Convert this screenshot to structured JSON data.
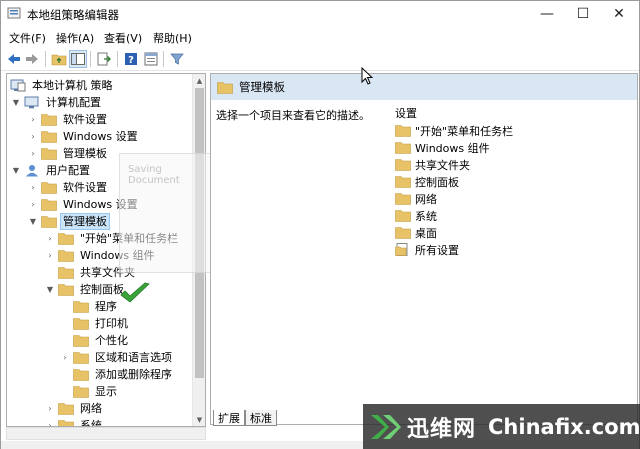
{
  "window": {
    "title": "本地组策略编辑器",
    "controls": {
      "minimize": "—",
      "maximize": "☐",
      "close": "✕"
    }
  },
  "menu": [
    "文件(F)",
    "操作(A)",
    "查看(V)",
    "帮助(H)"
  ],
  "toolbar": {
    "icons": [
      "back-arrow-icon",
      "forward-arrow-icon",
      "up-folder-icon",
      "show-hide-tree-icon",
      "export-list-icon",
      "help-icon",
      "properties-icon",
      "filter-icon"
    ]
  },
  "tree": {
    "root": "本地计算机 策略",
    "computer_config": "计算机配置",
    "cc_software": "软件设置",
    "cc_windows": "Windows 设置",
    "cc_admin": "管理模板",
    "user_config": "用户配置",
    "uc_software": "软件设置",
    "uc_windows": "Windows 设置",
    "uc_admin": "管理模板",
    "start_menu": "\"开始\"菜单和任务栏",
    "win_components": "Windows 组件",
    "shared_folders": "共享文件夹",
    "control_panel": "控制面板",
    "programs": "程序",
    "printers": "打印机",
    "personalization": "个性化",
    "region": "区域和语言选项",
    "add_remove": "添加或删除程序",
    "display": "显示",
    "network": "网络",
    "system": "系统"
  },
  "right_pane": {
    "header": "管理模板",
    "description": "选择一个项目来查看它的描述。",
    "column": "设置",
    "items": [
      "\"开始\"菜单和任务栏",
      "Windows 组件",
      "共享文件夹",
      "控制面板",
      "网络",
      "系统",
      "桌面",
      "所有设置"
    ]
  },
  "tabs": [
    "扩展",
    "标准"
  ],
  "ghost": {
    "text": "Saving Document"
  },
  "watermark": {
    "cn": "迅维网",
    "en": "Chinafix.com"
  },
  "colors": {
    "folder": "#e8c266",
    "selection": "#cce4f7",
    "header": "#d9e6f4",
    "check": "#3aa33a"
  }
}
